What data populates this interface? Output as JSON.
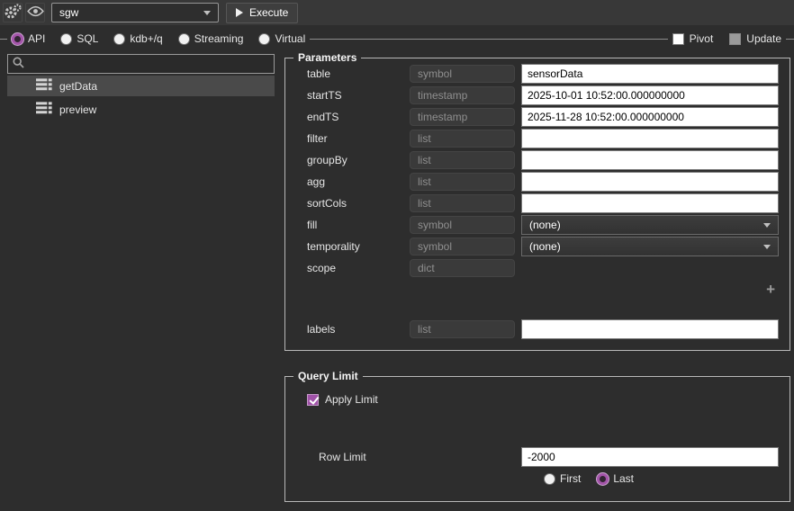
{
  "toolbar": {
    "connection_value": "sgw",
    "execute_label": "Execute"
  },
  "query_type_tabs": {
    "options": [
      {
        "label": "API",
        "selected": true
      },
      {
        "label": "SQL",
        "selected": false
      },
      {
        "label": "kdb+/q",
        "selected": false
      },
      {
        "label": "Streaming",
        "selected": false
      },
      {
        "label": "Virtual",
        "selected": false
      }
    ],
    "pivot_label": "Pivot",
    "pivot_checked": false,
    "update_label": "Update",
    "update_enabled": false
  },
  "sidebar": {
    "search_placeholder": "",
    "items": [
      {
        "label": "getData",
        "selected": true
      },
      {
        "label": "preview",
        "selected": false
      }
    ]
  },
  "parameters": {
    "legend": "Parameters",
    "rows": [
      {
        "label": "table",
        "type": "symbol",
        "value": "sensorData"
      },
      {
        "label": "startTS",
        "type": "timestamp",
        "value": "2025-10-01 10:52:00.000000000"
      },
      {
        "label": "endTS",
        "type": "timestamp",
        "value": "2025-11-28 10:52:00.000000000"
      },
      {
        "label": "filter",
        "type": "list",
        "value": ""
      },
      {
        "label": "groupBy",
        "type": "list",
        "value": ""
      },
      {
        "label": "agg",
        "type": "list",
        "value": ""
      },
      {
        "label": "sortCols",
        "type": "list",
        "value": ""
      },
      {
        "label": "fill",
        "type": "symbol",
        "value": "(none)"
      },
      {
        "label": "temporality",
        "type": "symbol",
        "value": "(none)"
      },
      {
        "label": "scope",
        "type": "dict",
        "value": ""
      },
      {
        "label": "labels",
        "type": "list",
        "value": ""
      }
    ],
    "add_button_label": "+"
  },
  "query_limit": {
    "legend": "Query Limit",
    "apply_limit_label": "Apply Limit",
    "apply_limit_checked": true,
    "row_limit_label": "Row Limit",
    "row_limit_value": "-2000",
    "order_options": [
      {
        "label": "First",
        "selected": false
      },
      {
        "label": "Last",
        "selected": true
      }
    ]
  },
  "colors": {
    "accent_purple": "#a052a8",
    "background": "#2d2d2d",
    "toolbar_background": "#383838",
    "selected_row": "#4a4a4a",
    "group_border": "#b8b8b8"
  }
}
